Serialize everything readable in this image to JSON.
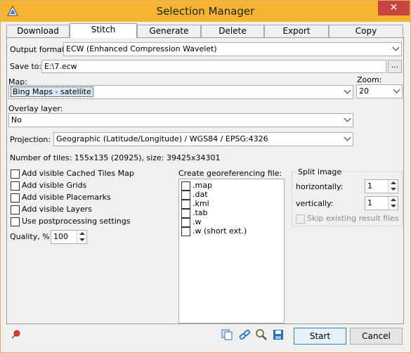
{
  "window": {
    "title": "Selection Manager",
    "close_glyph": "✕"
  },
  "tabs": [
    {
      "label": "Download"
    },
    {
      "label": "Stitch"
    },
    {
      "label": "Generate"
    },
    {
      "label": "Delete"
    },
    {
      "label": "Export"
    },
    {
      "label": "Copy"
    }
  ],
  "form": {
    "output_format_label": "Output format:",
    "output_format_value": "ECW (Enhanced Compression Wavelet)",
    "save_to_label": "Save to:",
    "save_to_value": "E:\\7.ecw",
    "browse_label": "...",
    "map_label": "Map:",
    "map_value": "Bing Maps - satellite",
    "zoom_label": "Zoom:",
    "zoom_value": "20",
    "overlay_label": "Overlay layer:",
    "overlay_value": "No",
    "projection_label": "Projection:",
    "projection_value": "Geographic (Latitude/Longitude) / WGS84 / EPSG:4326",
    "tiles_info": "Number of tiles: 155x135 (20925), size: 39425x34301"
  },
  "options": [
    {
      "label": "Add visible Cached Tiles Map",
      "checked": false
    },
    {
      "label": "Add visible Grids",
      "checked": false
    },
    {
      "label": "Add visible Placemarks",
      "checked": false
    },
    {
      "label": "Add visible Layers",
      "checked": false
    },
    {
      "label": "Use postprocessing settings",
      "checked": false
    }
  ],
  "quality": {
    "label": "Quality, %",
    "value": "100"
  },
  "georef": {
    "label": "Create georeferencing file:",
    "items": [
      {
        "label": ".map"
      },
      {
        "label": ".dat"
      },
      {
        "label": ".kml"
      },
      {
        "label": ".tab"
      },
      {
        "label": ".w"
      },
      {
        "label": ".w (short ext.)"
      }
    ]
  },
  "split": {
    "legend": "Split image",
    "horizontally_label": "horizontally:",
    "horizontally_value": "1",
    "vertically_label": "vertically:",
    "vertically_value": "1",
    "skip_label": "Skip existing result files"
  },
  "buttons": {
    "start": "Start",
    "cancel": "Cancel"
  },
  "colors": {
    "titlebar": "#f5b533",
    "close": "#c7453f",
    "primary_border": "#3c7fb1"
  },
  "icons": [
    "pin-icon",
    "copy-icon",
    "link-icon",
    "zoom-icon",
    "save-icon"
  ]
}
